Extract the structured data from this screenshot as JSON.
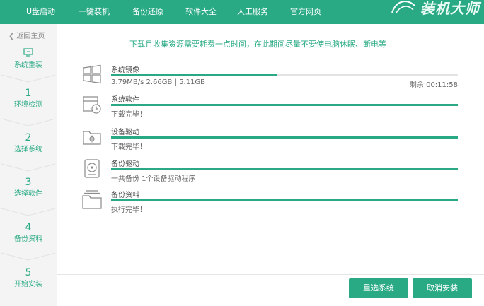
{
  "nav": {
    "items": [
      "U盘启动",
      "一键装机",
      "备份还原",
      "软件大全",
      "人工服务",
      "官方网页"
    ],
    "brand": "装机大师"
  },
  "sidebar": {
    "back": "返回主页",
    "current": "系统重装",
    "steps": [
      {
        "num": "1",
        "label": "环境检测"
      },
      {
        "num": "2",
        "label": "选择系统"
      },
      {
        "num": "3",
        "label": "选择软件"
      },
      {
        "num": "4",
        "label": "备份资料"
      },
      {
        "num": "5",
        "label": "开始安装"
      }
    ]
  },
  "notice": "下载且收集资源需要耗费一点时间，在此期间尽量不要使电脑休眠、断电等",
  "items": [
    {
      "title": "系统镜像",
      "sub": "3.79MB/s 2.66GB | 5.11GB",
      "remain": "剩余 00:11:58",
      "progress": 0.48,
      "icon": "windows-icon"
    },
    {
      "title": "系统软件",
      "sub": "下载完毕！",
      "progress": 1.0,
      "icon": "software-box-icon"
    },
    {
      "title": "设备驱动",
      "sub": "下载完毕！",
      "progress": 1.0,
      "icon": "driver-folder-icon"
    },
    {
      "title": "备份驱动",
      "sub": "一共备份 1个设备驱动程序",
      "progress": 1.0,
      "icon": "disk-backup-icon"
    },
    {
      "title": "备份资料",
      "sub": "执行完毕！",
      "progress": 1.0,
      "icon": "data-folder-icon"
    }
  ],
  "buttons": {
    "reselect": "重选系统",
    "cancel": "取消安装"
  },
  "colors": {
    "accent": "#2aaa84",
    "track": "#e3e3e3"
  }
}
